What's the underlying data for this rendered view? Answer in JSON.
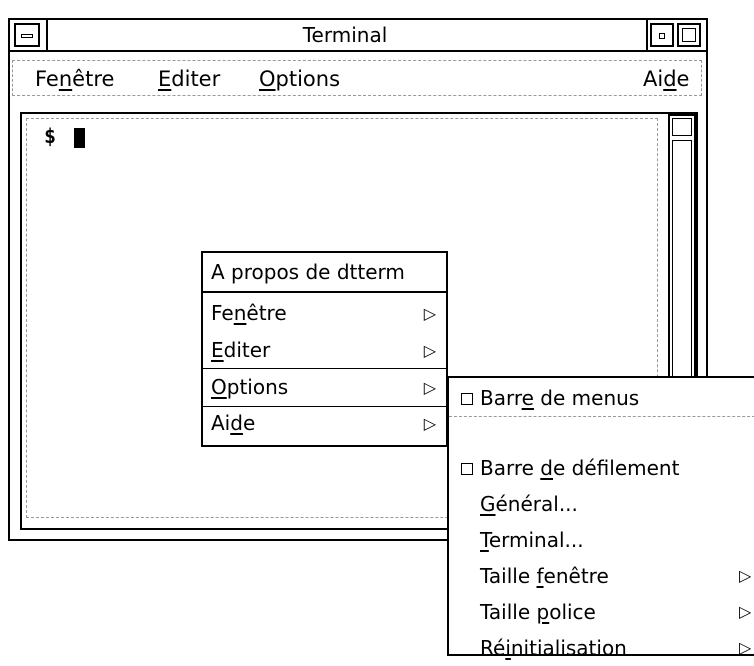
{
  "window": {
    "title": "Terminal",
    "menu": [
      {
        "pre": "Fe",
        "u": "n",
        "post": "être"
      },
      {
        "pre": "",
        "u": "E",
        "post": "diter"
      },
      {
        "pre": "",
        "u": "O",
        "post": "ptions"
      },
      {
        "pre": "Ai",
        "u": "d",
        "post": "e"
      }
    ]
  },
  "terminal": {
    "prompt": "$"
  },
  "popup": {
    "title": "A propos de dtterm",
    "items": [
      {
        "pre": "Fe",
        "u": "n",
        "post": "être",
        "arrow": "▷"
      },
      {
        "pre": "",
        "u": "E",
        "post": "diter",
        "arrow": "▷"
      },
      {
        "pre": "",
        "u": "O",
        "post": "ptions",
        "arrow": "▷"
      },
      {
        "pre": "Ai",
        "u": "d",
        "post": "e",
        "arrow": "▷"
      }
    ]
  },
  "submenu": {
    "items": [
      {
        "pre": "Barr",
        "u": "e",
        "post": " de menus"
      },
      {
        "pre": "Barre ",
        "u": "d",
        "post": "e défilement"
      },
      {
        "pre": "",
        "u": "G",
        "post": "énéral..."
      },
      {
        "pre": "",
        "u": "T",
        "post": "erminal..."
      },
      {
        "pre": "Taille ",
        "u": "f",
        "post": "enêtre",
        "arrow": "▷"
      },
      {
        "pre": "Taille ",
        "u": "p",
        "post": "olice",
        "arrow": "▷"
      },
      {
        "pre": "Ré",
        "u": "i",
        "post": "nitialisation",
        "arrow": "▷"
      }
    ]
  }
}
